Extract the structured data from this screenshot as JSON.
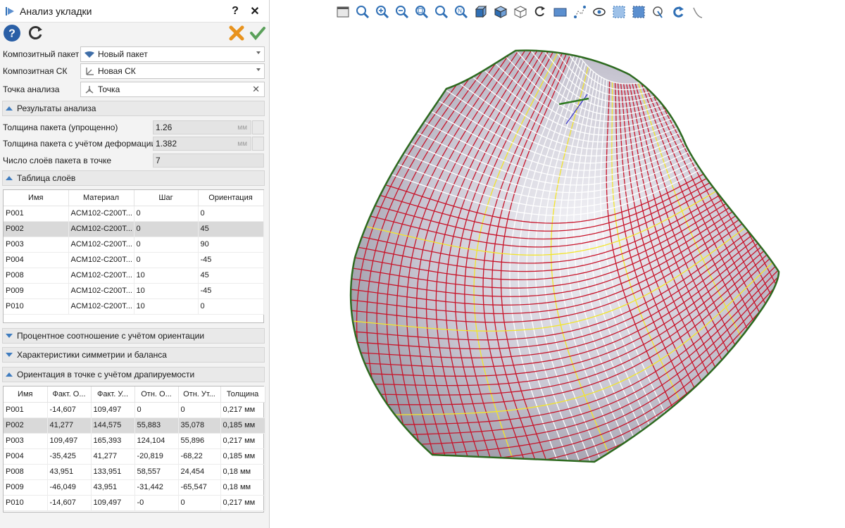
{
  "window": {
    "title": "Анализ укладки",
    "help_label": "?",
    "close_label": "✕"
  },
  "form": {
    "composite_pack_label": "Композитный пакет",
    "composite_pack_value": "Новый пакет",
    "composite_cs_label": "Композитная СК",
    "composite_cs_value": "Новая СК",
    "analysis_point_label": "Точка анализа",
    "analysis_point_value": "Точка",
    "clear_label": "✕"
  },
  "results": {
    "section_label": "Результаты анализа",
    "thickness_simple_label": "Толщина пакета (упрощенно)",
    "thickness_simple_value": "1.26",
    "thickness_def_label": "Толщина пакета с учётом деформации",
    "thickness_def_value": "1.382",
    "unit": "мм",
    "layers_count_label": "Число слоёв пакета в точке",
    "layers_count_value": "7"
  },
  "layers_table": {
    "section_label": "Таблица слоёв",
    "headers": [
      "Имя",
      "Материал",
      "Шаг",
      "Ориентация"
    ],
    "rows": [
      [
        "P001",
        "ACM102-C200T...",
        "0",
        "0"
      ],
      [
        "P002",
        "ACM102-C200T...",
        "0",
        "45"
      ],
      [
        "P003",
        "ACM102-C200T...",
        "0",
        "90"
      ],
      [
        "P004",
        "ACM102-C200T...",
        "0",
        "-45"
      ],
      [
        "P008",
        "ACM102-C200T...",
        "10",
        "45"
      ],
      [
        "P009",
        "ACM102-C200T...",
        "10",
        "-45"
      ],
      [
        "P010",
        "ACM102-C200T...",
        "10",
        "0"
      ]
    ]
  },
  "collapsed_sections": {
    "orientation_ratio": "Процентное соотношение с учётом ориентации",
    "symmetry": "Характеристики симметрии и баланса"
  },
  "drape_table": {
    "section_label": "Ориентация в точке с учётом драпируемости",
    "headers": [
      "Имя",
      "Факт. О...",
      "Факт. У...",
      "Отн. О...",
      "Отн. Ут...",
      "Толщина"
    ],
    "rows": [
      [
        "P001",
        "-14,607",
        "109,497",
        "0",
        "0",
        "0,217 мм"
      ],
      [
        "P002",
        "41,277",
        "144,575",
        "55,883",
        "35,078",
        "0,185 мм"
      ],
      [
        "P003",
        "109,497",
        "165,393",
        "124,104",
        "55,896",
        "0,217 мм"
      ],
      [
        "P004",
        "-35,425",
        "41,277",
        "-20,819",
        "-68,22",
        "0,185 мм"
      ],
      [
        "P008",
        "43,951",
        "133,951",
        "58,557",
        "24,454",
        "0,18 мм"
      ],
      [
        "P009",
        "-46,049",
        "43,951",
        "-31,442",
        "-65,547",
        "0,18 мм"
      ],
      [
        "P010",
        "-14,607",
        "109,497",
        "-0",
        "0",
        "0,217 мм"
      ]
    ]
  },
  "toolbar": {
    "icons": [
      "window-icon",
      "zoom-fit-icon",
      "zoom-in-icon",
      "zoom-out-icon",
      "zoom-window-icon",
      "zoom-previous-icon",
      "normal-view-icon",
      "view-front-icon",
      "view-iso-icon",
      "view-wire-icon",
      "rotate-menu-icon",
      "plane-icon",
      "points-icon",
      "visibility-icon",
      "select-box-icon",
      "select-all-icon",
      "pick-icon",
      "refresh-icon",
      "curve-icon"
    ]
  },
  "colors": {
    "accent_blue": "#2f6fb5",
    "ok_green": "#5aa05a",
    "cancel_orange": "#e8931e",
    "mesh_red": "#c8142a",
    "mesh_yellow": "#f3e52a",
    "edge_green": "#2d6a1f"
  }
}
